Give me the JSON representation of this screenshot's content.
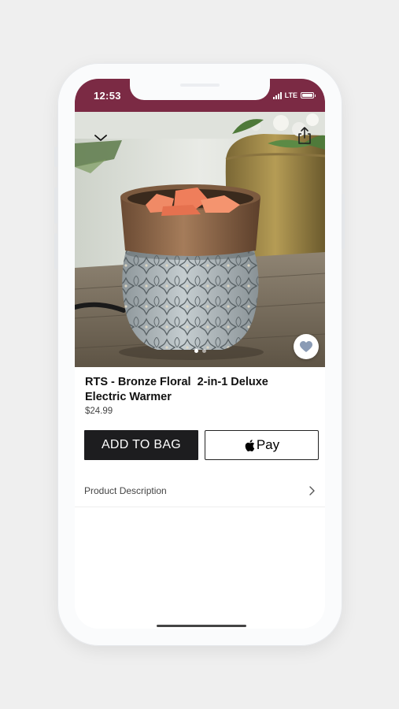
{
  "status_bar": {
    "time": "12:53",
    "network": "LTE",
    "background_color": "#7b2a44"
  },
  "nav": {
    "back_icon": "chevron-down-icon",
    "share_icon": "share-icon"
  },
  "product": {
    "title": "RTS - Bronze Floral  2-in-1 Deluxe\nElectric Warmer",
    "price": "$24.99",
    "image_description_icon": "bronze-floral-warmer-photo",
    "favorite_icon": "heart-icon",
    "carousel_pages": 2,
    "carousel_active_page": 1
  },
  "actions": {
    "add_to_bag_label": "ADD TO BAG",
    "apple_pay_label": "Pay",
    "apple_pay_icon": "apple-logo-icon"
  },
  "description": {
    "label": "Product Description",
    "icon": "chevron-right-icon"
  },
  "colors": {
    "accent": "#7b2a44",
    "button_dark": "#1d1d1f",
    "heart": "#8a9bb5"
  }
}
